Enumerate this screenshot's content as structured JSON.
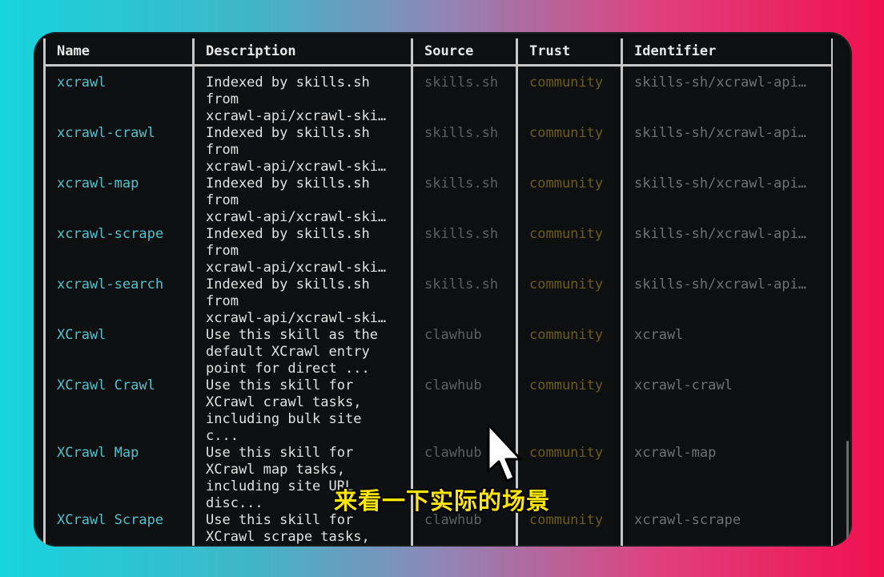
{
  "table": {
    "headers": [
      "Name",
      "Description",
      "Source",
      "Trust",
      "Identifier"
    ],
    "rows": [
      {
        "name": "xcrawl",
        "description": "Indexed by skills.sh\nfrom\nxcrawl-api/xcrawl-ski…",
        "source": "skills.sh",
        "trust": "community",
        "identifier": "skills-sh/xcrawl-api…"
      },
      {
        "name": "xcrawl-crawl",
        "description": "Indexed by skills.sh\nfrom\nxcrawl-api/xcrawl-ski…",
        "source": "skills.sh",
        "trust": "community",
        "identifier": "skills-sh/xcrawl-api…"
      },
      {
        "name": "xcrawl-map",
        "description": "Indexed by skills.sh\nfrom\nxcrawl-api/xcrawl-ski…",
        "source": "skills.sh",
        "trust": "community",
        "identifier": "skills-sh/xcrawl-api…"
      },
      {
        "name": "xcrawl-scrape",
        "description": "Indexed by skills.sh\nfrom\nxcrawl-api/xcrawl-ski…",
        "source": "skills.sh",
        "trust": "community",
        "identifier": "skills-sh/xcrawl-api…"
      },
      {
        "name": "xcrawl-search",
        "description": "Indexed by skills.sh\nfrom\nxcrawl-api/xcrawl-ski…",
        "source": "skills.sh",
        "trust": "community",
        "identifier": "skills-sh/xcrawl-api…"
      },
      {
        "name": "XCrawl",
        "description": "Use this skill as the\ndefault XCrawl entry\npoint for direct ...",
        "source": "clawhub",
        "trust": "community",
        "identifier": "xcrawl"
      },
      {
        "name": "XCrawl Crawl",
        "description": "Use this skill for\nXCrawl crawl tasks,\nincluding bulk site\nc...",
        "source": "clawhub",
        "trust": "community",
        "identifier": "xcrawl-crawl"
      },
      {
        "name": "XCrawl Map",
        "description": "Use this skill for\nXCrawl map tasks,\nincluding site URL\ndisc...",
        "source": "clawhub",
        "trust": "community",
        "identifier": "xcrawl-map"
      },
      {
        "name": "XCrawl Scrape",
        "description": "Use this skill for\nXCrawl scrape tasks,",
        "source": "clawhub",
        "trust": "community",
        "identifier": "xcrawl-scrape"
      }
    ]
  },
  "subtitle": "来看一下实际的场景",
  "icons": {
    "pointer": "mouse-pointer-icon"
  },
  "colors": {
    "name": "#4fc3cf",
    "trust": "#6b5c1e",
    "description": "#e2e2e2"
  }
}
